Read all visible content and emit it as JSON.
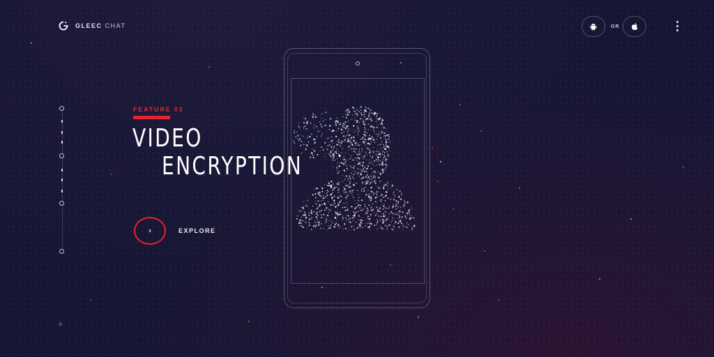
{
  "header": {
    "brand_bold": "GLEEC",
    "brand_light": "CHAT",
    "or_label": "OR"
  },
  "icons": {
    "logo": "gleec-logo-icon",
    "android": "android-icon",
    "apple": "apple-icon",
    "menu": "more-vertical-icon",
    "explore_arrow": "chevron-right-icon",
    "plus": "plus-icon"
  },
  "hero": {
    "eyebrow": "FEATURE 03",
    "title_line1": "VIDEO",
    "title_line2": "ENCRYPTION",
    "cta_label": "EXPLORE"
  },
  "colors": {
    "accent": "#e5232f",
    "background": "#161634"
  }
}
